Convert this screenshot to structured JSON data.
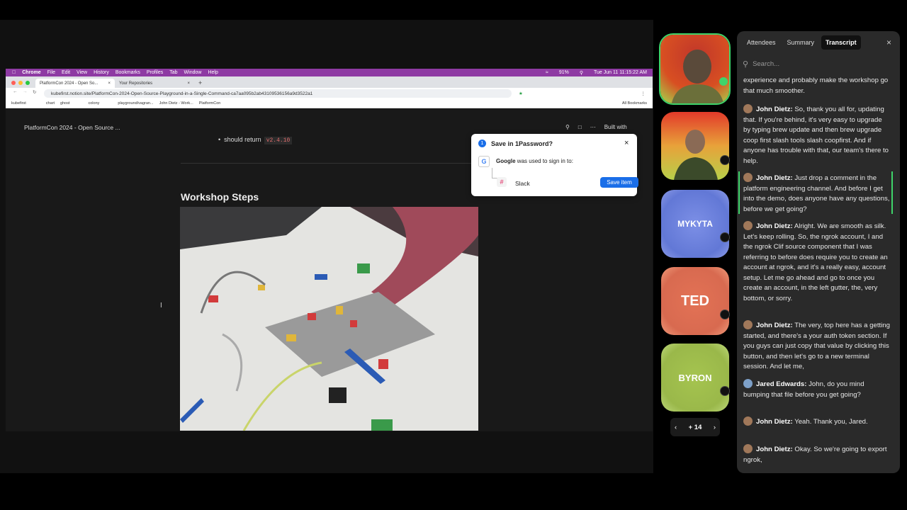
{
  "browser": {
    "app": "Chrome",
    "menu": [
      "File",
      "Edit",
      "View",
      "History",
      "Bookmarks",
      "Profiles",
      "Tab",
      "Window",
      "Help"
    ],
    "battery": "91%",
    "datetime": "Tue Jun 11  11:15:22 AM",
    "tabs": [
      "PlatformCon 2024 - Open So...",
      "Your Repositories"
    ],
    "url": "kubefirst.notion.site/PlatformCon-2024-Open-Source-Playground-in-a-Single-Command-ca7aa095b2ab43109536156a9d3522a1",
    "bookmarks": [
      "kubefirst",
      "chart",
      "ghost",
      "colony",
      "playground/vagran...",
      "John Dietz - Work...",
      "PlatformCon"
    ],
    "all_bookmarks": "All Bookmarks"
  },
  "notion": {
    "page_title": "PlatformCon 2024 - Open Source ...",
    "built_with": "Built with",
    "bullet_text": "should return",
    "bullet_code": "v2.4.10",
    "heading": "Workshop Steps"
  },
  "password_popup": {
    "title": "Save in 1Password?",
    "google": "Google",
    "used_text": "was used to sign in to:",
    "site": "Slack",
    "save_button": "Save item"
  },
  "participants": [
    {
      "name": ""
    },
    {
      "name": ""
    },
    {
      "name": "MYKYTA"
    },
    {
      "name": "TED"
    },
    {
      "name": "BYRON"
    }
  ],
  "pager": {
    "label": "+ 14"
  },
  "panel": {
    "tabs": [
      "Attendees",
      "Summary",
      "Transcript"
    ],
    "active_tab": "Transcript",
    "search_placeholder": "Search..."
  },
  "transcript": [
    {
      "speaker": "",
      "text": "experience and probably make the workshop go that much smoother."
    },
    {
      "speaker": "John Dietz:",
      "text": "So, thank you all for, updating that. If you're behind, it's very easy to upgrade by typing brew update and then brew upgrade coop first slash tools slash coopfirst. And if anyone has trouble with that, our team's there to help."
    },
    {
      "speaker": "John Dietz:",
      "text": "Just drop a comment in the platform engineering channel. And before I get into the demo, does anyone have any questions, before we get going?"
    },
    {
      "speaker": "John Dietz:",
      "text": "Alright. We are smooth as silk. Let's keep rolling. So, the ngrok account, I and the ngrok Clif source component that I was referring to before does require you to create an account at ngrok, and it's a really easy, account setup. Let me go ahead and go to once you create an account, in the left gutter, the, very bottom, or sorry."
    },
    {
      "speaker": "John Dietz:",
      "text": "The very, top here has a getting started, and there's a your auth token section. If you guys can just copy that value by clicking this button, and then let's go to a new terminal session. And let me,"
    },
    {
      "speaker": "Jared Edwards:",
      "text": "John, do you mind bumping that file before you get going?"
    },
    {
      "speaker": "John Dietz:",
      "text": "Yeah. Thank you, Jared."
    },
    {
      "speaker": "John Dietz:",
      "text": "Okay. So we're going to export ngrok,"
    }
  ],
  "colors": {
    "accent_green": "#3fd46a",
    "save_blue": "#1a6ee8",
    "mac_bar": "#8e3aa3"
  }
}
